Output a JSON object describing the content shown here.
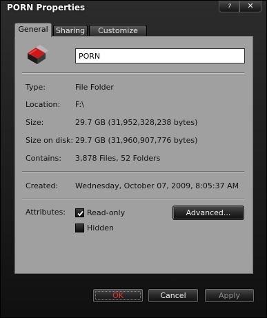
{
  "window": {
    "title": "PORN Properties",
    "help_glyph": "?",
    "close_glyph": "✕"
  },
  "tabs": [
    "General",
    "Sharing",
    "Customize"
  ],
  "general": {
    "name_value": "PORN",
    "type": {
      "label": "Type:",
      "value": "File Folder"
    },
    "location": {
      "label": "Location:",
      "value": "F:\\"
    },
    "size": {
      "label": "Size:",
      "value": "29.7 GB (31,952,328,238 bytes)"
    },
    "size_on_disk": {
      "label": "Size on disk:",
      "value": "29.7 GB (31,960,907,776 bytes)"
    },
    "contains": {
      "label": "Contains:",
      "value": "3,878 Files, 52 Folders"
    },
    "created": {
      "label": "Created:",
      "value": "Wednesday, October 07, 2009, 8:05:37 AM"
    },
    "attributes": {
      "label": "Attributes:",
      "readonly": {
        "label": "Read-only",
        "checked": true
      },
      "hidden": {
        "label": "Hidden",
        "checked": false
      },
      "advanced_label": "Advanced..."
    }
  },
  "buttons": {
    "ok": "OK",
    "cancel": "Cancel",
    "apply": "Apply"
  },
  "colors": {
    "panel": "#a0a0a0",
    "frame": "#1a1a1a",
    "ok_text": "#e83030",
    "disabled_text": "#8a8a8a"
  }
}
